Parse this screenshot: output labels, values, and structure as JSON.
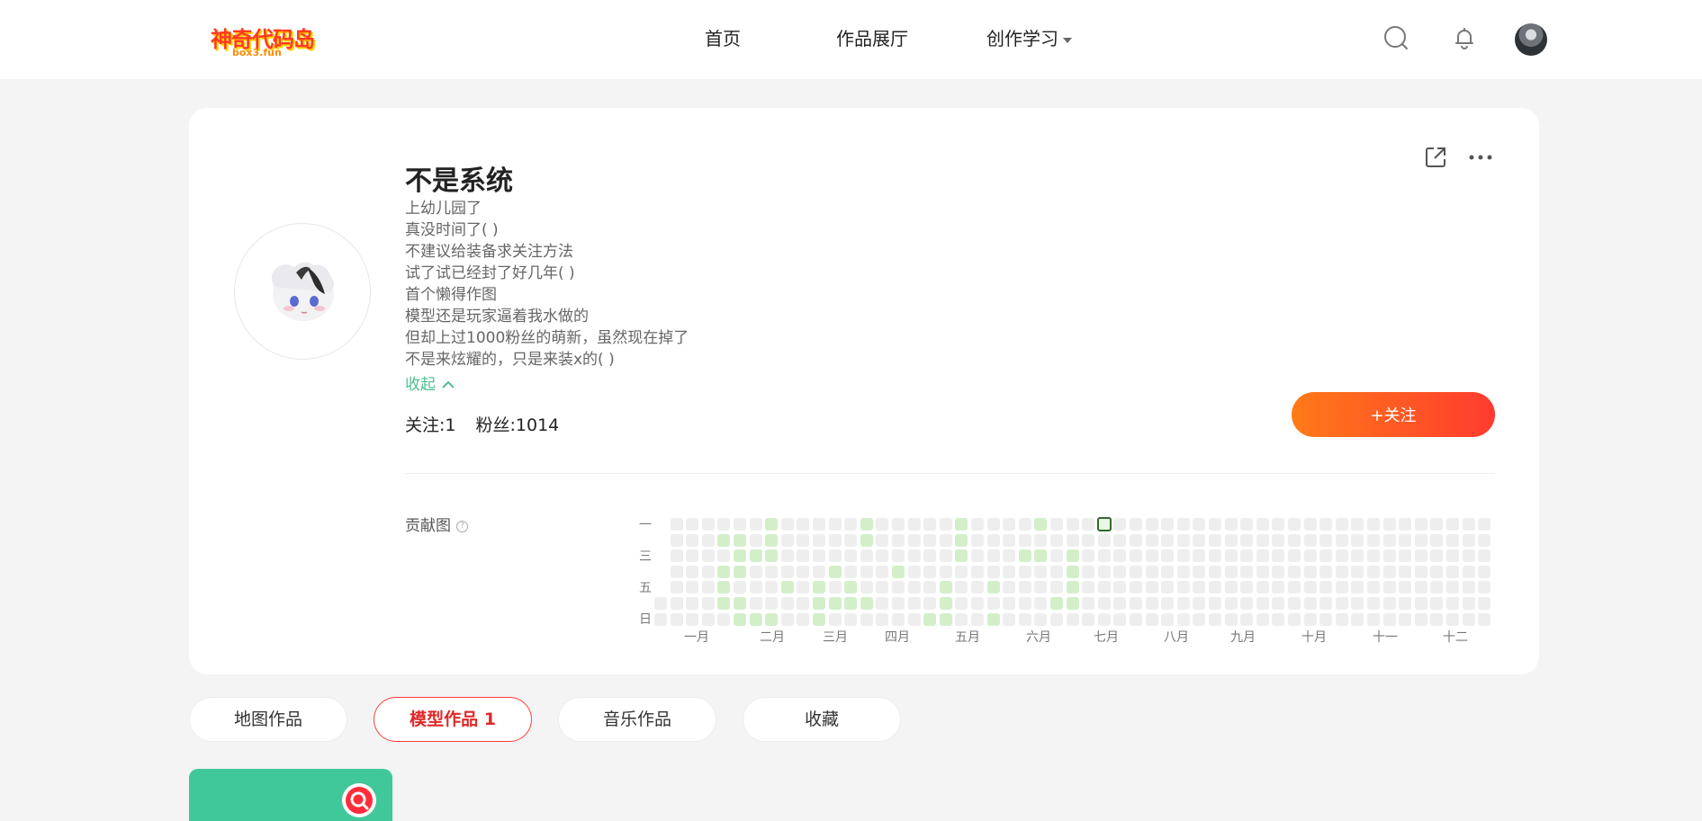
{
  "header": {
    "logo_text": "神奇代码岛",
    "logo_sub": "box3.fun",
    "nav": [
      {
        "label": "首页"
      },
      {
        "label": "作品展厅"
      },
      {
        "label": "创作学习"
      }
    ]
  },
  "profile": {
    "name": "不是系统",
    "bio": [
      "上幼儿园了",
      "真没时间了( )",
      "不建议给装备求关注方法",
      "试了试已经封了好几年( )",
      "首个懒得作图",
      "模型还是玩家逼着我水做的",
      "但却上过1000粉丝的萌新，虽然现在掉了",
      "不是来炫耀的，只是来装x的( )"
    ],
    "collapse_label": "收起",
    "following": "关注:1",
    "followers": "粉丝:1014",
    "follow_button": "+关注"
  },
  "contribution": {
    "label": "贡献图",
    "weekday_labels": [
      "一",
      "三",
      "五",
      "日"
    ],
    "months": [
      "一月",
      "二月",
      "三月",
      "四月",
      "五月",
      "六月",
      "七月",
      "八月",
      "九月",
      "十月",
      "十一",
      "十二"
    ]
  },
  "tabs": [
    {
      "label": "地图作品",
      "active": false
    },
    {
      "label": "模型作品 1",
      "active": true
    },
    {
      "label": "音乐作品",
      "active": false
    },
    {
      "label": "收藏",
      "active": false
    }
  ],
  "colors": {
    "accent_green": "#4dc08e",
    "follow_gradient_start": "#ff7a18",
    "follow_gradient_end": "#ff3b2f",
    "active_tab": "#e02828",
    "contrib_active": "#d3efca",
    "contrib_empty": "#eeeeee"
  }
}
